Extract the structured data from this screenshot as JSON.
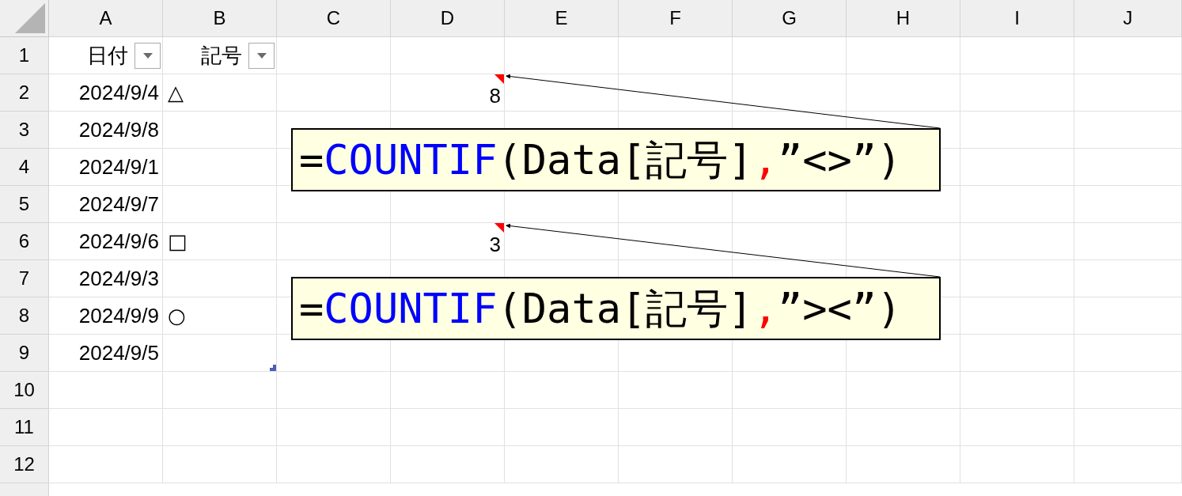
{
  "column_headers": [
    "A",
    "B",
    "C",
    "D",
    "E",
    "F",
    "G",
    "H",
    "I",
    "J"
  ],
  "row_numbers": [
    "1",
    "2",
    "3",
    "4",
    "5",
    "6",
    "7",
    "8",
    "9",
    "10",
    "11",
    "12"
  ],
  "table": {
    "columns": [
      {
        "label": "日付",
        "filter": true
      },
      {
        "label": "記号",
        "filter": true
      }
    ],
    "rows": [
      {
        "date": "2024/9/4",
        "symbol": "△",
        "column_d": {
          "value": "8",
          "comment": true
        }
      },
      {
        "date": "2024/9/8"
      },
      {
        "date": "2024/9/1"
      },
      {
        "date": "2024/9/7"
      },
      {
        "date": "2024/9/6",
        "symbol": "□",
        "column_d": {
          "value": "3",
          "comment": true
        }
      },
      {
        "date": "2024/9/3"
      },
      {
        "date": "2024/9/9",
        "symbol": "○"
      },
      {
        "date": "2024/9/5"
      }
    ]
  },
  "comments": [
    {
      "segments": [
        {
          "text": "=",
          "color": "#000000"
        },
        {
          "text": "COUNTIF",
          "color": "#0000ff"
        },
        {
          "text": "(Data[記号]",
          "color": "#000000"
        },
        {
          "text": ",",
          "color": "#ff0000"
        },
        {
          "text": "”<>”)",
          "color": "#000000"
        }
      ]
    },
    {
      "segments": [
        {
          "text": "=",
          "color": "#000000"
        },
        {
          "text": "COUNTIF",
          "color": "#0000ff"
        },
        {
          "text": "(Data[記号]",
          "color": "#000000"
        },
        {
          "text": ",",
          "color": "#ff0000"
        },
        {
          "text": "”><”)",
          "color": "#000000"
        }
      ]
    }
  ]
}
